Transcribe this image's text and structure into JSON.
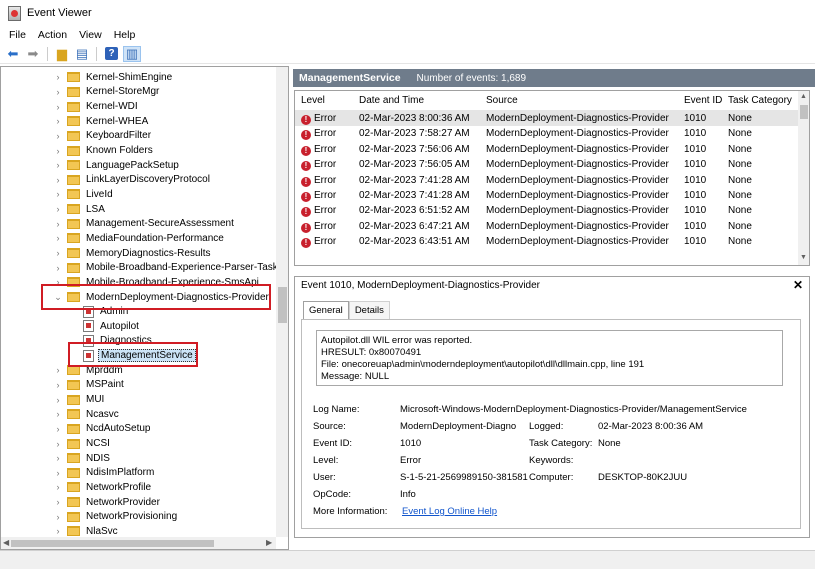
{
  "window": {
    "title": "Event Viewer"
  },
  "menu": [
    "File",
    "Action",
    "View",
    "Help"
  ],
  "toolbar": {
    "icons": [
      "back-arrow-icon",
      "forward-arrow-icon",
      "up-folder-icon",
      "properties-icon",
      "help-icon",
      "show-hide-pane-icon"
    ],
    "help_glyph": "?"
  },
  "tree": {
    "items": [
      {
        "label": "Kernel-ShimEngine",
        "type": "folder",
        "expander": "›"
      },
      {
        "label": "Kernel-StoreMgr",
        "type": "folder",
        "expander": "›"
      },
      {
        "label": "Kernel-WDI",
        "type": "folder",
        "expander": "›"
      },
      {
        "label": "Kernel-WHEA",
        "type": "folder",
        "expander": "›"
      },
      {
        "label": "KeyboardFilter",
        "type": "folder",
        "expander": "›"
      },
      {
        "label": "Known Folders",
        "type": "folder",
        "expander": "›"
      },
      {
        "label": "LanguagePackSetup",
        "type": "folder",
        "expander": "›"
      },
      {
        "label": "LinkLayerDiscoveryProtocol",
        "type": "folder",
        "expander": "›"
      },
      {
        "label": "LiveId",
        "type": "folder",
        "expander": "›"
      },
      {
        "label": "LSA",
        "type": "folder",
        "expander": "›"
      },
      {
        "label": "Management-SecureAssessment",
        "type": "folder",
        "expander": "›"
      },
      {
        "label": "MediaFoundation-Performance",
        "type": "folder",
        "expander": "›"
      },
      {
        "label": "MemoryDiagnostics-Results",
        "type": "folder",
        "expander": "›"
      },
      {
        "label": "Mobile-Broadband-Experience-Parser-Task",
        "type": "folder",
        "expander": "›"
      },
      {
        "label": "Mobile-Broadband-Experience-SmsApi",
        "type": "folder",
        "expander": "›"
      },
      {
        "label": "ModernDeployment-Diagnostics-Provider",
        "type": "folder",
        "expander": "⌄",
        "expanded": true
      },
      {
        "label": "Admin",
        "type": "log",
        "child": true
      },
      {
        "label": "Autopilot",
        "type": "log",
        "child": true
      },
      {
        "label": "Diagnostics",
        "type": "log",
        "child": true
      },
      {
        "label": "ManagementService",
        "type": "log",
        "child": true,
        "selected": true
      },
      {
        "label": "Mprddm",
        "type": "folder",
        "expander": "›"
      },
      {
        "label": "MSPaint",
        "type": "folder",
        "expander": "›"
      },
      {
        "label": "MUI",
        "type": "folder",
        "expander": "›"
      },
      {
        "label": "Ncasvc",
        "type": "folder",
        "expander": "›"
      },
      {
        "label": "NcdAutoSetup",
        "type": "folder",
        "expander": "›"
      },
      {
        "label": "NCSI",
        "type": "folder",
        "expander": "›"
      },
      {
        "label": "NDIS",
        "type": "folder",
        "expander": "›"
      },
      {
        "label": "NdisImPlatform",
        "type": "folder",
        "expander": "›"
      },
      {
        "label": "NetworkProfile",
        "type": "folder",
        "expander": "›"
      },
      {
        "label": "NetworkProvider",
        "type": "folder",
        "expander": "›"
      },
      {
        "label": "NetworkProvisioning",
        "type": "folder",
        "expander": "›"
      },
      {
        "label": "NlaSvc",
        "type": "folder",
        "expander": "›"
      }
    ]
  },
  "log_header": {
    "name": "ManagementService",
    "count": "Number of events: 1,689"
  },
  "events": {
    "columns": [
      "Level",
      "Date and Time",
      "Source",
      "Event ID",
      "Task Category"
    ],
    "rows": [
      {
        "level": "Error",
        "date": "02-Mar-2023 8:00:36 AM",
        "source": "ModernDeployment-Diagnostics-Provider",
        "id": "1010",
        "task": "None"
      },
      {
        "level": "Error",
        "date": "02-Mar-2023 7:58:27 AM",
        "source": "ModernDeployment-Diagnostics-Provider",
        "id": "1010",
        "task": "None"
      },
      {
        "level": "Error",
        "date": "02-Mar-2023 7:56:06 AM",
        "source": "ModernDeployment-Diagnostics-Provider",
        "id": "1010",
        "task": "None"
      },
      {
        "level": "Error",
        "date": "02-Mar-2023 7:56:05 AM",
        "source": "ModernDeployment-Diagnostics-Provider",
        "id": "1010",
        "task": "None"
      },
      {
        "level": "Error",
        "date": "02-Mar-2023 7:41:28 AM",
        "source": "ModernDeployment-Diagnostics-Provider",
        "id": "1010",
        "task": "None"
      },
      {
        "level": "Error",
        "date": "02-Mar-2023 7:41:28 AM",
        "source": "ModernDeployment-Diagnostics-Provider",
        "id": "1010",
        "task": "None"
      },
      {
        "level": "Error",
        "date": "02-Mar-2023 6:51:52 AM",
        "source": "ModernDeployment-Diagnostics-Provider",
        "id": "1010",
        "task": "None"
      },
      {
        "level": "Error",
        "date": "02-Mar-2023 6:47:21 AM",
        "source": "ModernDeployment-Diagnostics-Provider",
        "id": "1010",
        "task": "None"
      },
      {
        "level": "Error",
        "date": "02-Mar-2023 6:43:51 AM",
        "source": "ModernDeployment-Diagnostics-Provider",
        "id": "1010",
        "task": "None"
      }
    ]
  },
  "detail": {
    "header": "Event 1010, ModernDeployment-Diagnostics-Provider",
    "close": "✕",
    "tabs": [
      "General",
      "Details"
    ],
    "message": [
      "Autopilot.dll WIL error was reported.",
      "HRESULT: 0x80070491",
      "File: onecoreuap\\admin\\moderndeployment\\autopilot\\dll\\dllmain.cpp, line 191",
      "Message: NULL"
    ],
    "fields": {
      "log_name_label": "Log Name:",
      "log_name": "Microsoft-Windows-ModernDeployment-Diagnostics-Provider/ManagementService",
      "source_label": "Source:",
      "source": "ModernDeployment-Diagno",
      "logged_label": "Logged:",
      "logged": "02-Mar-2023 8:00:36 AM",
      "event_id_label": "Event ID:",
      "event_id": "1010",
      "task_label": "Task Category:",
      "task": "None",
      "level_label": "Level:",
      "level": "Error",
      "keywords_label": "Keywords:",
      "user_label": "User:",
      "user": "S-1-5-21-2569989150-381581",
      "computer_label": "Computer:",
      "computer": "DESKTOP-80K2JUU",
      "opcode_label": "OpCode:",
      "opcode": "Info",
      "more_label": "More Information:",
      "more_link": "Event Log Online Help"
    }
  },
  "colors": {
    "header_bg": "#6f7c8b",
    "highlight_box": "#d01c24",
    "selection": "#cce4f7",
    "error": "#c8202d"
  }
}
